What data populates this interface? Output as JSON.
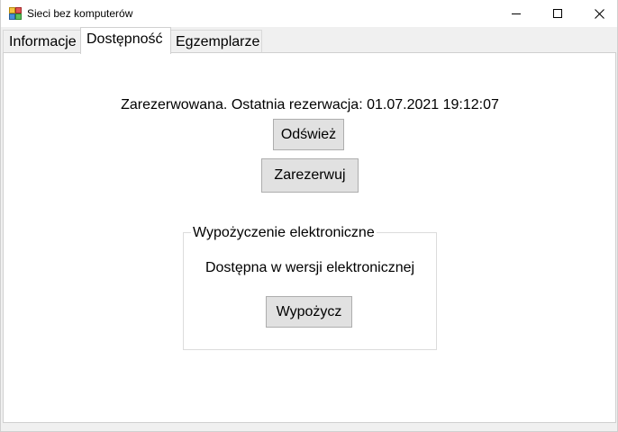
{
  "window": {
    "title": "Sieci bez komputerów"
  },
  "tabs": [
    {
      "label": "Informacje",
      "selected": false
    },
    {
      "label": "Dostępność",
      "selected": true
    },
    {
      "label": "Egzemplarze",
      "selected": false
    }
  ],
  "availability": {
    "status_text": "Zarezerwowana. Ostatnia rezerwacja: 01.07.2021 19:12:07",
    "refresh_label": "Odśwież",
    "reserve_label": "Zarezerwuj"
  },
  "electronic": {
    "group_title": "Wypożyczenie elektroniczne",
    "status_text": "Dostępna w wersji elektronicznej",
    "borrow_label": "Wypożycz"
  },
  "icons": {
    "app": "app-window-icon",
    "minimize": "minimize-icon",
    "maximize": "maximize-icon",
    "close": "close-icon"
  },
  "colors": {
    "tab_page_bg": "#ffffff",
    "chrome_bg": "#f0f0f0",
    "button_bg": "#e1e1e1",
    "button_border": "#adadad"
  }
}
